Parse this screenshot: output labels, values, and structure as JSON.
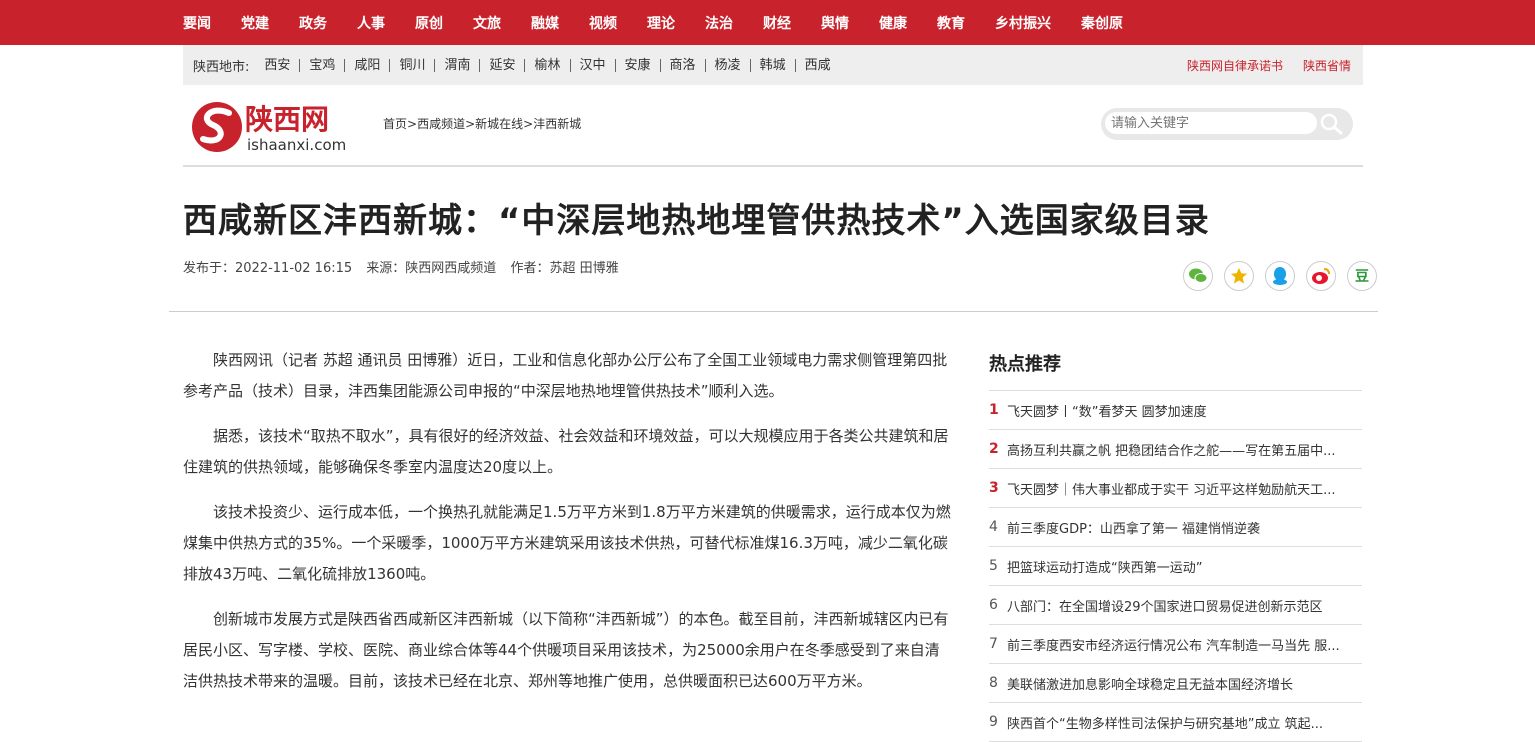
{
  "topnav": [
    "要闻",
    "党建",
    "政务",
    "人事",
    "原创",
    "文旅",
    "融媒",
    "视频",
    "理论",
    "法治",
    "财经",
    "舆情",
    "健康",
    "教育",
    "乡村振兴",
    "秦创原"
  ],
  "citybar": {
    "label": "陕西地市:",
    "cities": [
      "西安",
      "宝鸡",
      "咸阳",
      "铜川",
      "渭南",
      "延安",
      "榆林",
      "汉中",
      "安康",
      "商洛",
      "杨凌",
      "韩城",
      "西咸"
    ],
    "right_links": [
      "陕西网自律承诺书",
      "陕西省情"
    ]
  },
  "header": {
    "logo_text": "陕西网",
    "logo_domain": "ishaanxi.com",
    "breadcrumb": [
      "首页",
      "西咸频道",
      "新城在线",
      "沣西新城"
    ],
    "search_placeholder": "请输入关键字"
  },
  "article": {
    "title": "西咸新区沣西新城：“中深层地热地埋管供热技术”入选国家级目录",
    "published": "发布于：2022-11-02 16:15",
    "source": "来源：陕西网西咸频道",
    "author": "作者：苏超 田博雅",
    "paragraphs": [
      "陕西网讯（记者 苏超 通讯员 田博雅）近日，工业和信息化部办公厅公布了全国工业领域电力需求侧管理第四批参考产品（技术）目录，沣西集团能源公司申报的“中深层地热地埋管供热技术”顺利入选。",
      "据悉，该技术“取热不取水”，具有很好的经济效益、社会效益和环境效益，可以大规模应用于各类公共建筑和居住建筑的供热领域，能够确保冬季室内温度达20度以上。",
      "该技术投资少、运行成本低，一个换热孔就能满足1.5万平方米到1.8万平方米建筑的供暖需求，运行成本仅为燃煤集中供热方式的35%。一个采暖季，1000万平方米建筑采用该技术供热，可替代标准煤16.3万吨，减少二氧化碳排放43万吨、二氧化硫排放1360吨。",
      "创新城市发展方式是陕西省西咸新区沣西新城（以下简称“沣西新城”）的本色。截至目前，沣西新城辖区内已有居民小区、写字楼、学校、医院、商业综合体等44个供暖项目采用该技术，为25000余用户在冬季感受到了来自清洁供热技术带来的温暖。目前，该技术已经在北京、郑州等地推广使用，总供暖面积已达600万平方米。"
    ]
  },
  "share_icons": [
    "wechat-icon",
    "qzone-icon",
    "qq-icon",
    "weibo-icon",
    "douban-icon"
  ],
  "douban_glyph": "豆",
  "sidebar": {
    "title": "热点推荐",
    "items": [
      {
        "num": "1",
        "text": "飞天圆梦丨“数”看梦天 圆梦加速度"
      },
      {
        "num": "2",
        "text": "高扬互利共赢之帆 把稳团结合作之舵——写在第五届中..."
      },
      {
        "num": "3",
        "text": "飞天圆梦｜伟大事业都成于实干 习近平这样勉励航天工..."
      },
      {
        "num": "4",
        "text": "前三季度GDP：山西拿了第一 福建悄悄逆袭"
      },
      {
        "num": "5",
        "text": "把篮球运动打造成“陕西第一运动”"
      },
      {
        "num": "6",
        "text": "八部门：在全国增设29个国家进口贸易促进创新示范区"
      },
      {
        "num": "7",
        "text": "前三季度西安市经济运行情况公布 汽车制造一马当先 服..."
      },
      {
        "num": "8",
        "text": "美联储激进加息影响全球稳定且无益本国经济增长"
      },
      {
        "num": "9",
        "text": "陕西首个“生物多样性司法保护与研究基地”成立 筑起..."
      }
    ]
  },
  "colors": {
    "brand_red": "#c8232c",
    "wechat": "#5fb43e",
    "qzone": "#f0b400",
    "qq": "#1aa0e8",
    "weibo": "#e6162d",
    "douban": "#2e963d"
  }
}
